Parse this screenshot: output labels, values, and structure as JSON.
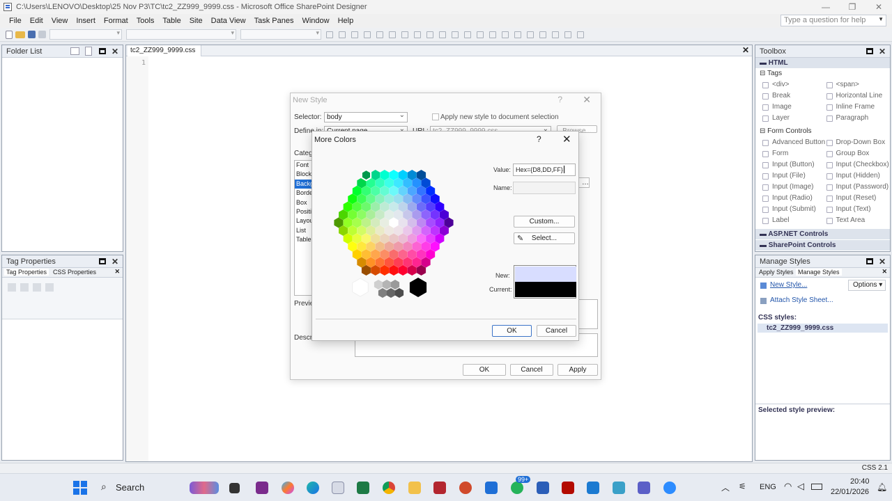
{
  "window": {
    "title": "C:\\Users\\LENOVO\\Desktop\\25 Nov P3\\TC\\tc2_ZZ999_9999.css - Microsoft Office SharePoint Designer",
    "minimize": "—",
    "restore": "❐",
    "close": "✕"
  },
  "menu": {
    "items": [
      "File",
      "Edit",
      "View",
      "Insert",
      "Format",
      "Tools",
      "Table",
      "Site",
      "Data View",
      "Task Panes",
      "Window",
      "Help"
    ],
    "help_placeholder": "Type a question for help"
  },
  "folder_list": {
    "title": "Folder List"
  },
  "tag_properties": {
    "title": "Tag Properties",
    "tab1": "Tag Properties",
    "tab2": "CSS Properties"
  },
  "editor": {
    "tab": "tc2_ZZ999_9999.css",
    "line1": "1"
  },
  "toolbox": {
    "title": "Toolbox",
    "html_section": "HTML",
    "tags_label": "Tags",
    "tags": [
      "<div>",
      "<span>",
      "Break",
      "Horizontal Line",
      "Image",
      "Inline Frame",
      "Layer",
      "Paragraph"
    ],
    "form_controls_label": "Form Controls",
    "form_controls": [
      "Advanced Button",
      "Drop-Down Box",
      "Form",
      "Group Box",
      "Input (Button)",
      "Input (Checkbox)",
      "Input (File)",
      "Input (Hidden)",
      "Input (Image)",
      "Input (Password)",
      "Input (Radio)",
      "Input (Reset)",
      "Input (Submit)",
      "Input (Text)",
      "Label",
      "Text Area"
    ],
    "aspnet": "ASP.NET Controls",
    "sharepoint": "SharePoint Controls"
  },
  "manage_styles": {
    "title": "Manage Styles",
    "tab_apply": "Apply Styles",
    "tab_manage": "Manage Styles",
    "new_style": "New Style...",
    "options": "Options",
    "attach": "Attach Style Sheet...",
    "css_styles": "CSS styles:",
    "css_file": "tc2_ZZ999_9999.css",
    "preview_label": "Selected style preview:"
  },
  "new_style": {
    "title": "New Style",
    "help": "?",
    "selector_label": "Selector:",
    "selector_value": "body",
    "apply_checkbox": "Apply new style to document selection",
    "define_label": "Define in:",
    "define_value": "Current page",
    "url_label": "URL:",
    "url_value": "tc2_ZZ999_9999.css",
    "browse": "Browse...",
    "category_label": "Category:",
    "categories": [
      "Font",
      "Block",
      "Background",
      "Border",
      "Box",
      "Position",
      "Layout",
      "List",
      "Table"
    ],
    "selected_category_index": 2,
    "preview_label": "Preview:",
    "description_label": "Description:",
    "ok": "OK",
    "cancel": "Cancel",
    "apply": "Apply"
  },
  "more_colors": {
    "title": "More Colors",
    "help": "?",
    "value_label": "Value:",
    "value": "Hex={D8,DD,FF}",
    "name_label": "Name:",
    "name_value": "",
    "custom": "Custom...",
    "select": "Select...",
    "new_label": "New:",
    "current_label": "Current:",
    "new_color": "#D8DDFF",
    "current_color": "#000000",
    "ok": "OK",
    "cancel": "Cancel"
  },
  "status": {
    "css_level": "CSS 2.1"
  },
  "taskbar": {
    "search": "Search",
    "language": "ENG",
    "time": "20:40",
    "date": "22/01/2026",
    "badge": "99+"
  }
}
